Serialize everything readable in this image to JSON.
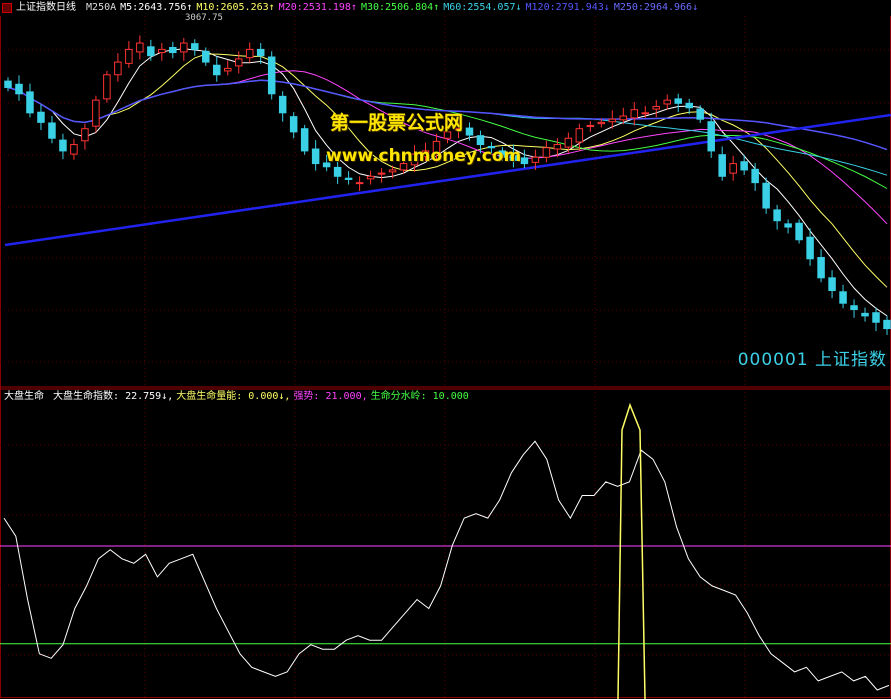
{
  "header": {
    "title": "上证指数日线",
    "ma_items": [
      {
        "label": "M250A",
        "value": "",
        "color": "#dddddd"
      },
      {
        "label": "M5:",
        "value": "2643.756↑",
        "color": "#ffffff"
      },
      {
        "label": "M10:",
        "value": "2605.263↑",
        "color": "#ffff66"
      },
      {
        "label": "M20:",
        "value": "2531.198↑",
        "color": "#ff44ff"
      },
      {
        "label": "M30:",
        "value": "2506.804↑",
        "color": "#44ff44"
      },
      {
        "label": "M60:",
        "value": "2554.057↓",
        "color": "#3ad1e6"
      },
      {
        "label": "M120:",
        "value": "2791.943↓",
        "color": "#5555ff"
      },
      {
        "label": "M250:",
        "value": "2964.966↓",
        "color": "#6a6aff"
      }
    ]
  },
  "top_panel": {
    "code_label": "000001 上证指数",
    "watermark_name": "第一股票公式网",
    "watermark_url": "www.chnmoney.com",
    "price_label": "3067.75",
    "colors": {
      "up": "#ff3333",
      "down": "#3ad1e6"
    }
  },
  "sub_panel": {
    "name": "大盘生命",
    "items": [
      {
        "label": "大盘生命指数:",
        "value": "22.759↓,",
        "color": "#ffffff"
      },
      {
        "label": "大盘生命量能:",
        "value": "0.000↓,",
        "color": "#ffff66"
      },
      {
        "label": "强势:",
        "value": "21.000,",
        "color": "#ff44ff"
      },
      {
        "label": "生命分水岭:",
        "value": "10.000",
        "color": "#44ff44"
      }
    ]
  },
  "chart_data": {
    "type": "line",
    "grid": true,
    "candles_close": [
      3000,
      2990,
      2960,
      2945,
      2920,
      2900,
      2910,
      2935,
      2980,
      3020,
      3040,
      3060,
      3070,
      3050,
      3060,
      3055,
      3070,
      3060,
      3040,
      3020,
      3030,
      3045,
      3060,
      3050,
      2990,
      2960,
      2930,
      2900,
      2880,
      2875,
      2860,
      2855,
      2850,
      2860,
      2865,
      2870,
      2880,
      2895,
      2900,
      2915,
      2930,
      2935,
      2925,
      2910,
      2905,
      2890,
      2885,
      2880,
      2890,
      2905,
      2910,
      2920,
      2935,
      2940,
      2945,
      2950,
      2955,
      2965,
      2960,
      2970,
      2980,
      2975,
      2968,
      2950,
      2900,
      2860,
      2880,
      2870,
      2850,
      2810,
      2790,
      2780,
      2760,
      2730,
      2700,
      2680,
      2660,
      2650,
      2640,
      2630,
      2620
    ],
    "life_index": {
      "values": [
        40,
        36,
        22,
        10,
        9,
        12,
        20,
        25,
        31,
        33,
        31,
        30,
        32,
        27,
        30,
        31,
        32,
        26,
        20,
        15,
        10,
        7,
        6,
        5,
        6,
        10,
        12,
        11,
        11,
        13,
        14,
        13,
        13,
        16,
        19,
        22,
        20,
        25,
        34,
        40,
        41,
        40,
        44,
        50,
        54,
        57,
        53,
        44,
        40,
        45,
        45,
        48,
        47,
        48,
        55,
        53,
        48,
        38,
        31,
        27,
        25,
        24,
        23,
        19,
        14,
        10,
        8,
        6,
        7,
        4,
        5,
        6,
        4,
        5,
        2,
        3
      ],
      "color": "#ffffff"
    },
    "life_volume": {
      "x_range": [
        115,
        130
      ],
      "values": [
        60,
        0
      ],
      "color": "#ffff66"
    },
    "strong_line": {
      "value": 21,
      "color": "#ff44ff"
    },
    "watershed_line": {
      "value": 10,
      "color": "#44ff44"
    }
  }
}
